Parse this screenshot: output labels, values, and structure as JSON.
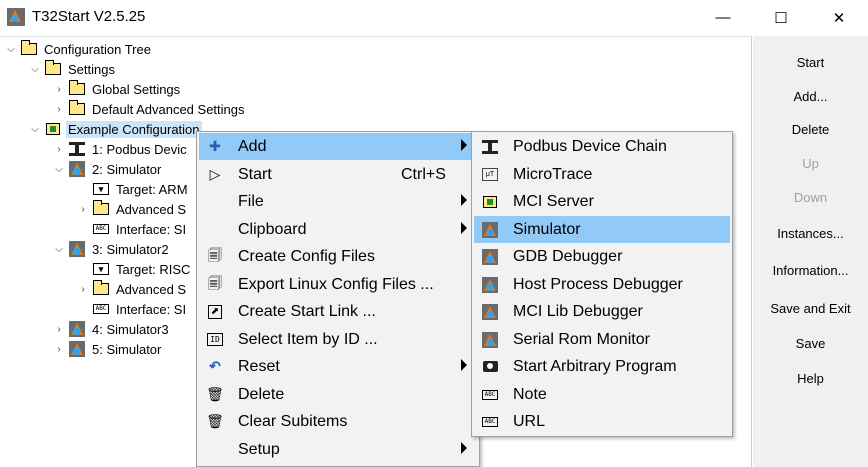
{
  "window": {
    "title": "T32Start V2.5.25",
    "minimize_glyph": "—",
    "maximize_glyph": "☐",
    "close_glyph": "✕"
  },
  "tree": {
    "nodes": [
      {
        "label": "Configuration Tree",
        "icon": "folder-icon",
        "expanded": true
      },
      {
        "label": "Settings",
        "icon": "folder-icon",
        "expanded": true
      },
      {
        "label": "Global Settings",
        "icon": "folder-icon",
        "expanded": false
      },
      {
        "label": "Default Advanced Settings",
        "icon": "folder-icon",
        "expanded": false
      },
      {
        "label": "Example Configuration",
        "icon": "config-folder-icon",
        "expanded": true,
        "selected": true
      },
      {
        "label": "1: Podbus Devic",
        "icon": "podbus-chain-icon",
        "expanded": false
      },
      {
        "label": "2: Simulator",
        "icon": "simulator-icon",
        "expanded": true
      },
      {
        "label": "Target: ARM",
        "icon": "target-icon"
      },
      {
        "label": "Advanced S",
        "icon": "folder-icon",
        "expanded": false
      },
      {
        "label": "Interface: SI",
        "icon": "abc-icon"
      },
      {
        "label": "3: Simulator2",
        "icon": "simulator-icon",
        "expanded": true
      },
      {
        "label": "Target: RISC",
        "icon": "target-icon"
      },
      {
        "label": "Advanced S",
        "icon": "folder-icon",
        "expanded": false
      },
      {
        "label": "Interface: SI",
        "icon": "abc-icon"
      },
      {
        "label": "4: Simulator3",
        "icon": "simulator-icon",
        "expanded": false
      },
      {
        "label": "5: Simulator",
        "icon": "simulator-icon",
        "expanded": false
      }
    ]
  },
  "side_buttons": [
    {
      "label": "Start",
      "enabled": true
    },
    {
      "label": "Add...",
      "enabled": true
    },
    {
      "label": "Delete",
      "enabled": true
    },
    {
      "label": "Up",
      "enabled": false
    },
    {
      "label": "Down",
      "enabled": false
    },
    {
      "label": "Instances...",
      "enabled": true
    },
    {
      "label": "Information...",
      "enabled": true
    },
    {
      "label": "Save and Exit",
      "enabled": true
    },
    {
      "label": "Save",
      "enabled": true
    },
    {
      "label": "Help",
      "enabled": true
    }
  ],
  "context_menu": {
    "items": [
      {
        "label": "Add",
        "icon": "plus-icon",
        "glyph": "✚",
        "submenu": true,
        "highlighted": true
      },
      {
        "label": "Start",
        "icon": "play-icon",
        "glyph": "▷",
        "shortcut": "Ctrl+S"
      },
      {
        "label": "File",
        "submenu": true
      },
      {
        "label": "Clipboard",
        "submenu": true
      },
      {
        "label": "Create Config Files",
        "icon": "config-files-icon",
        "glyph": "🗐"
      },
      {
        "label": "Export Linux Config Files ...",
        "icon": "export-files-icon",
        "glyph": "🗐"
      },
      {
        "label": "Create Start Link ...",
        "icon": "link-icon",
        "glyph": "⬈"
      },
      {
        "label": "Select Item by ID ...",
        "icon": "id-icon",
        "glyph": "ID"
      },
      {
        "label": "Reset",
        "icon": "undo-icon",
        "glyph": "↶",
        "submenu": true
      },
      {
        "label": "Delete",
        "icon": "trash-icon",
        "glyph": "🗑"
      },
      {
        "label": "Clear Subitems",
        "icon": "clear-icon",
        "glyph": "🗑"
      },
      {
        "label": "Setup",
        "submenu": true
      }
    ]
  },
  "add_submenu": {
    "items": [
      {
        "label": "Podbus Device Chain",
        "icon": "podbus-chain-icon"
      },
      {
        "label": "MicroTrace",
        "icon": "microtrace-icon"
      },
      {
        "label": "MCI Server",
        "icon": "mci-server-icon"
      },
      {
        "label": "Simulator",
        "icon": "simulator-icon",
        "highlighted": true
      },
      {
        "label": "GDB Debugger",
        "icon": "gdb-debugger-icon"
      },
      {
        "label": "Host Process Debugger",
        "icon": "host-process-icon"
      },
      {
        "label": "MCI Lib Debugger",
        "icon": "mci-lib-icon"
      },
      {
        "label": "Serial Rom Monitor",
        "icon": "serial-rom-icon"
      },
      {
        "label": "Start Arbitrary Program",
        "icon": "camera-icon"
      },
      {
        "label": "Note",
        "icon": "abc-icon"
      },
      {
        "label": "URL",
        "icon": "abc-icon"
      }
    ]
  },
  "colors": {
    "menu_highlight": "#91c9f7",
    "tree_selection": "#cce4f7",
    "folder": "#ffe88a",
    "panel_bg": "#f0f0f0"
  }
}
